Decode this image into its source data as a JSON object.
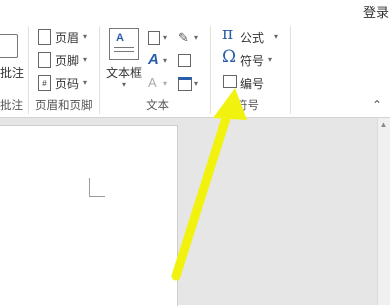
{
  "window": {
    "login_label": "登录"
  },
  "ribbon": {
    "group_comment": {
      "button_label": "批注",
      "group_label": "批注"
    },
    "group_header_footer": {
      "header_label": "页眉",
      "footer_label": "页脚",
      "page_number_label": "页码",
      "group_label": "页眉和页脚"
    },
    "group_text": {
      "textbox_label": "文本框",
      "group_label": "文本"
    },
    "group_symbols": {
      "equation_label": "公式",
      "symbol_label": "符号",
      "numbering_label": "编号",
      "group_label": "符号"
    }
  },
  "annotation": {
    "arrow_color": "#f2f20f"
  }
}
